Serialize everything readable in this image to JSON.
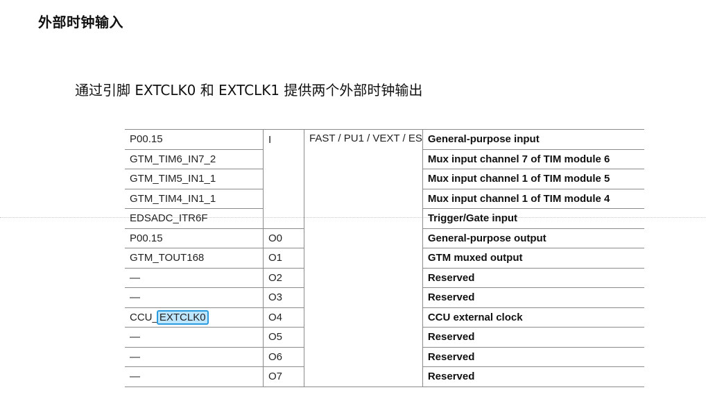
{
  "page": {
    "title": "外部时钟输入",
    "description": "通过引脚 EXTCLK0 和 EXTCLK1 提供两个外部时钟输出"
  },
  "table": {
    "port_type": "FAST / PU1 / VEXT / ES",
    "rows": [
      {
        "signal": "P00.15",
        "io": "I",
        "function": "General-purpose input"
      },
      {
        "signal": "GTM_TIM6_IN7_2",
        "io": "",
        "function": "Mux input channel 7 of TIM module 6"
      },
      {
        "signal": "GTM_TIM5_IN1_1",
        "io": "",
        "function": "Mux input channel 1 of TIM module 5"
      },
      {
        "signal": "GTM_TIM4_IN1_1",
        "io": "",
        "function": "Mux input channel 1 of TIM module 4"
      },
      {
        "signal": "EDSADC_ITR6F",
        "io": "",
        "function": "Trigger/Gate input"
      },
      {
        "signal": "P00.15",
        "io": "O0",
        "function": "General-purpose output"
      },
      {
        "signal": "GTM_TOUT168",
        "io": "O1",
        "function": "GTM muxed output"
      },
      {
        "signal": "—",
        "io": "O2",
        "function": "Reserved"
      },
      {
        "signal": "—",
        "io": "O3",
        "function": "Reserved"
      },
      {
        "signal_prefix": "CCU_",
        "signal_highlight": "EXTCLK0",
        "io": "O4",
        "function": "CCU external clock"
      },
      {
        "signal": "—",
        "io": "O5",
        "function": "Reserved"
      },
      {
        "signal": "—",
        "io": "O6",
        "function": "Reserved"
      },
      {
        "signal": "—",
        "io": "O7",
        "function": "Reserved"
      }
    ]
  },
  "colors": {
    "highlight_fill": "#bfe6ff",
    "highlight_border": "#2b9be0"
  }
}
